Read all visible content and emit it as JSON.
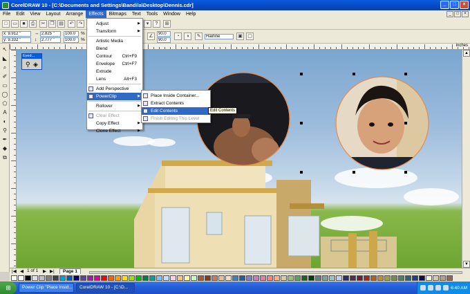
{
  "window": {
    "title": "CorelDRAW 10 - [C:\\Documents and Settings\\Bandila\\Desktop\\Dennis.cdr]",
    "buttons": [
      "_",
      "□",
      "×"
    ]
  },
  "menubar": {
    "items": [
      "File",
      "Edit",
      "View",
      "Layout",
      "Arrange",
      "Effects",
      "Bitmaps",
      "Text",
      "Tools",
      "Window",
      "Help"
    ],
    "active": "Effects",
    "doc_buttons": [
      "_",
      "□",
      "×"
    ]
  },
  "propbar": {
    "x": "x: 9.912 \"",
    "y": "y: 9.332 \"",
    "w": "2.825 \"",
    "h": "2.777 \"",
    "sx": "100.0",
    "sy": "100.0",
    "angle1": "90.0",
    "angle2": "90.0",
    "outline": "Hairline"
  },
  "rulers": {
    "top_label": "inches"
  },
  "effects_menu": {
    "items": [
      {
        "label": "Adjust",
        "submenu": true
      },
      {
        "label": "Transform",
        "submenu": true
      },
      {
        "sep": true
      },
      {
        "label": "Artistic Media"
      },
      {
        "label": "Blend"
      },
      {
        "label": "Contour",
        "shortcut": "Ctrl+F9"
      },
      {
        "label": "Envelope",
        "shortcut": "Ctrl+F7"
      },
      {
        "label": "Extrude"
      },
      {
        "label": "Lens",
        "shortcut": "Alt+F3"
      },
      {
        "sep": true
      },
      {
        "label": "Add Perspective"
      },
      {
        "label": "PowerClip",
        "submenu": true,
        "highlighted": true
      },
      {
        "sep": true
      },
      {
        "label": "Rollover",
        "submenu": true
      },
      {
        "sep": true
      },
      {
        "label": "Clear Effect",
        "disabled": true
      },
      {
        "label": "Copy Effect",
        "submenu": true
      },
      {
        "label": "Clone Effect",
        "submenu": true
      }
    ]
  },
  "powerclip_menu": {
    "items": [
      {
        "label": "Place Inside Container..."
      },
      {
        "label": "Extract Contents"
      },
      {
        "label": "Edit Contents",
        "highlighted": true
      },
      {
        "label": "Finish Editing This Level",
        "disabled": true
      }
    ]
  },
  "tooltip": "Edit Contents",
  "docker": {
    "title": "Eyed..."
  },
  "pagebar": {
    "counter": "1 of 1",
    "page_tab": "Page 1"
  },
  "palette": {
    "colors": [
      "#ffffff",
      "#000000",
      "#e0e0e0",
      "#c0c0c0",
      "#808080",
      "#404040",
      "#00a0e0",
      "#0060c0",
      "#000080",
      "#6040a0",
      "#a020a0",
      "#e0009a",
      "#ff0000",
      "#ff6000",
      "#ffa000",
      "#ffe000",
      "#a0e000",
      "#00c000",
      "#008040",
      "#00a0a0",
      "#80c0ff",
      "#c0e0ff",
      "#ffd0e0",
      "#ffc080",
      "#ffffa0",
      "#c0ffc0",
      "#a06040",
      "#804020",
      "#c08060",
      "#e0c0a0",
      "#f0e0c0",
      "#4080c0",
      "#2060a0",
      "#8080c0",
      "#c080c0",
      "#e080a0",
      "#ff8080",
      "#ffb080",
      "#d0d0a0",
      "#a0c080",
      "#60a060",
      "#206020",
      "#004000",
      "#608080",
      "#80a0a0",
      "#a0c0c0",
      "#c0d0e0",
      "#303060",
      "#503050",
      "#702030",
      "#903020",
      "#b06020",
      "#c09030",
      "#a0a040",
      "#709050",
      "#508060",
      "#306070",
      "#204080",
      "#101040",
      "#f8f0d8",
      "#d8c8a8",
      "#b8a080",
      "#986850"
    ]
  },
  "taskbar": {
    "items": [
      "Power Clip \"Place Insid...",
      "CorelDRAW 10 - [C:\\D..."
    ],
    "clock": "6:40 AM"
  }
}
